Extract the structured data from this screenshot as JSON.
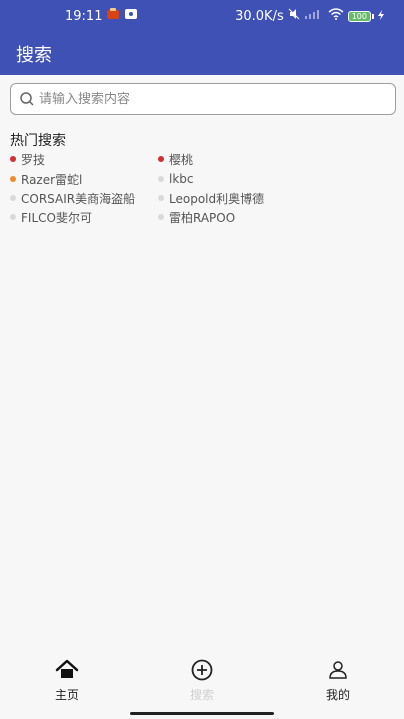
{
  "status_bar": {
    "time": "19:11",
    "network_speed": "30.0K/s",
    "battery": "100"
  },
  "app_bar": {
    "title": "搜索"
  },
  "search": {
    "placeholder": "请输入搜索内容",
    "value": ""
  },
  "hot_search": {
    "title": "热门搜索",
    "items": [
      {
        "label": "罗技",
        "dot_color": "#d32f2f"
      },
      {
        "label": "樱桃",
        "dot_color": "#d32f2f"
      },
      {
        "label": "Razer雷蛇l",
        "dot_color": "#f28b2b"
      },
      {
        "label": "lkbc",
        "dot_color": "#d9d9d9"
      },
      {
        "label": "CORSAIR美商海盗船",
        "dot_color": "#d9d9d9"
      },
      {
        "label": "Leopold利奥博德",
        "dot_color": "#d9d9d9"
      },
      {
        "label": "FILCO斐尔可",
        "dot_color": "#d9d9d9"
      },
      {
        "label": "雷柏RAPOO",
        "dot_color": "#d9d9d9"
      }
    ]
  },
  "bottom_nav": {
    "items": [
      {
        "label": "主页",
        "icon": "home-icon",
        "active": true
      },
      {
        "label": "搜索",
        "icon": "add-circle-icon",
        "active": false
      },
      {
        "label": "我的",
        "icon": "user-icon",
        "active": true
      }
    ]
  }
}
